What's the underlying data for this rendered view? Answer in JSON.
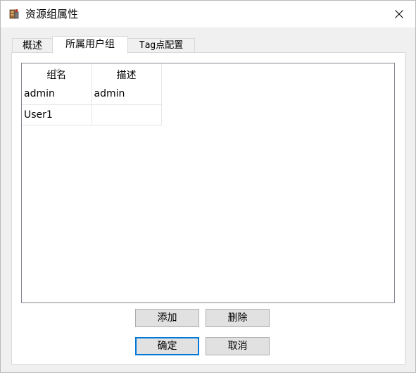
{
  "window": {
    "title": "资源组属性",
    "icon": "resource-group-app-icon",
    "close_icon": "close-icon"
  },
  "tabs": [
    {
      "label": "概述",
      "active": false
    },
    {
      "label": "所属用户组",
      "active": true
    },
    {
      "label": "Tag点配置",
      "active": false
    }
  ],
  "list": {
    "columns": [
      "组名",
      "描述"
    ],
    "sort_indicator": "sort-ascending-icon",
    "rows": [
      {
        "name": "admin",
        "description": "admin"
      },
      {
        "name": "User1",
        "description": ""
      }
    ]
  },
  "buttons": {
    "add": "添加",
    "delete": "删除",
    "ok": "确定",
    "cancel": "取消"
  },
  "colors": {
    "default_button_border": "#0078d7",
    "window_background": "#f0f0f0"
  }
}
